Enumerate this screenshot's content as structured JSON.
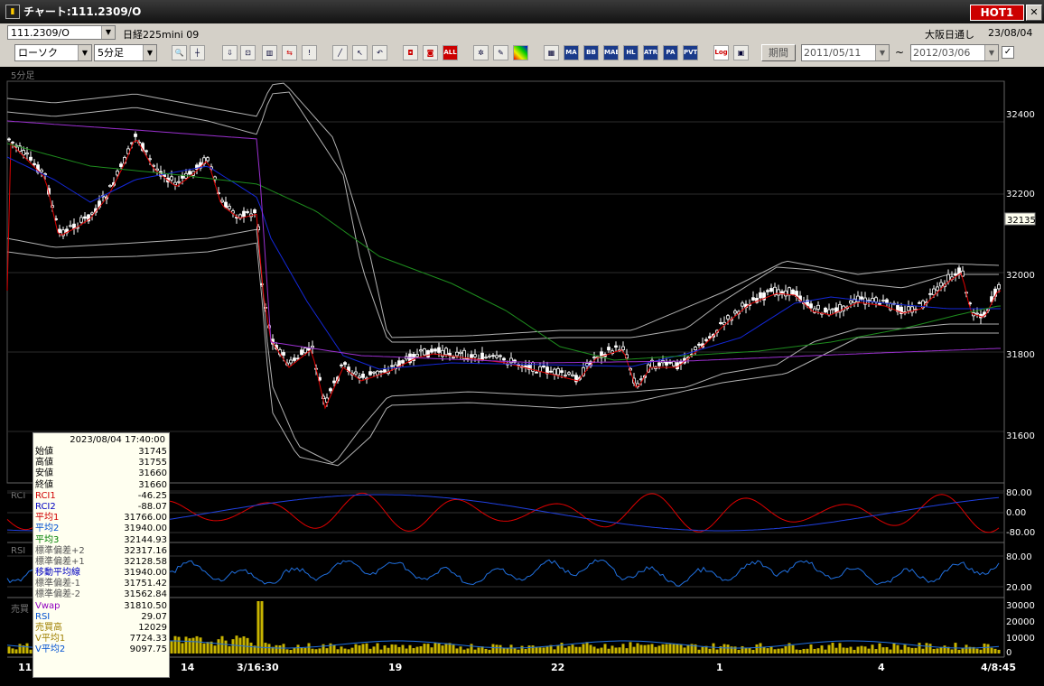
{
  "window": {
    "title": "チャート:111.2309/O",
    "hot_label": "HOT1",
    "controls": [
      "_",
      "□",
      "✕"
    ]
  },
  "header": {
    "symbol_code": "111.2309/O",
    "instrument_name": "日経225mini 09",
    "exchange_session": "大阪日通し",
    "date": "23/08/04"
  },
  "toolbar": {
    "chart_type": "ローソク",
    "interval": "5分足",
    "period_button": "期間",
    "date_from": "2011/05/11",
    "date_to": "2012/03/06",
    "tilde": "~",
    "icon_labels": {
      "ma": "MA",
      "bb": "BB",
      "mae": "MAE",
      "hl": "HL",
      "atr": "ATR",
      "pa": "PA",
      "pvt": "PVT",
      "all": "ALL",
      "log": "Log"
    }
  },
  "chart": {
    "panel_label": "5分足",
    "last_price": "32135",
    "price_ticks": [
      "32400",
      "32200",
      "32000",
      "31800",
      "31600"
    ],
    "rci_label": "RCI",
    "rci_ticks": [
      "80.00",
      "0.00",
      "-80.00"
    ],
    "rsi_label": "RSI",
    "rsi_ticks": [
      "80.00",
      "20.00"
    ],
    "vol_label": "売買",
    "vol_ticks": [
      "30000",
      "20000",
      "10000",
      "0"
    ],
    "date_labels": [
      "11",
      "14",
      "3/16:30",
      "19",
      "22",
      "1",
      "4",
      "4/8:45"
    ],
    "colors": {
      "candle": "#ffffff",
      "ma_short": "#e00000",
      "ma_mid": "#1428d8",
      "ma_long": "#1e8c1e",
      "bollinger": "#b0b0b0",
      "vwap": "#9b30d0",
      "rsi": "#2070e0",
      "volume": "#c8b400"
    }
  },
  "info": {
    "datetime": "2023/08/04  17:40:00",
    "rows": [
      {
        "label": "始値",
        "value": "31745",
        "color": "#000000"
      },
      {
        "label": "高値",
        "value": "31755",
        "color": "#000000"
      },
      {
        "label": "安値",
        "value": "31660",
        "color": "#000000"
      },
      {
        "label": "終値",
        "value": "31660",
        "color": "#000000"
      },
      {
        "label": "RCI1",
        "value": "-46.25",
        "color": "#d00000"
      },
      {
        "label": "RCI2",
        "value": "-88.07",
        "color": "#0000c0"
      },
      {
        "label": "平均1",
        "value": "31766.00",
        "color": "#d00000"
      },
      {
        "label": "平均2",
        "value": "31940.00",
        "color": "#0050d0"
      },
      {
        "label": "平均3",
        "value": "32144.93",
        "color": "#008000"
      },
      {
        "label": "標準偏差+2",
        "value": "32317.16",
        "color": "#555555"
      },
      {
        "label": "標準偏差+1",
        "value": "32128.58",
        "color": "#555555"
      },
      {
        "label": "移動平均線",
        "value": "31940.00",
        "color": "#0000c0"
      },
      {
        "label": "標準偏差-1",
        "value": "31751.42",
        "color": "#555555"
      },
      {
        "label": "標準偏差-2",
        "value": "31562.84",
        "color": "#555555"
      },
      {
        "label": "Vwap",
        "value": "31810.50",
        "color": "#9000c0"
      },
      {
        "label": "RSI",
        "value": "29.07",
        "color": "#0050d0"
      },
      {
        "label": "売買高",
        "value": "12029",
        "color": "#a08000"
      },
      {
        "label": "V平均1",
        "value": "7724.33",
        "color": "#a08000"
      },
      {
        "label": "V平均2",
        "value": "9097.75",
        "color": "#0050d0"
      }
    ]
  }
}
